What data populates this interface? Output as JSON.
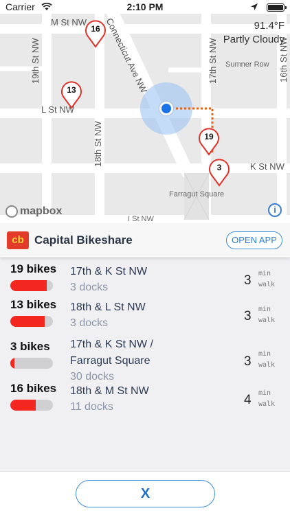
{
  "status_bar": {
    "carrier": "Carrier",
    "time": "2:10 PM",
    "icons": [
      "wifi-icon",
      "location-arrow-icon",
      "battery-icon"
    ]
  },
  "map": {
    "weather": {
      "temperature": "91.4°F",
      "condition": "Partly Cloudy"
    },
    "streets": {
      "m_st": "M St NW",
      "connecticut": "Connecticut Ave NW",
      "st_19th": "19th St NW",
      "st_17th": "17th St NW",
      "st_16th": "16th St NW",
      "sumner": "Sumner Row",
      "l_st": "L St NW",
      "st_18th": "18th St NW",
      "k_st": "K St NW",
      "farragut": "Farragut Square",
      "i_st": "I St NW"
    },
    "markers": [
      "16",
      "13",
      "19",
      "3"
    ],
    "attribution": "mapbox",
    "info_label": "i"
  },
  "header": {
    "logo_text": "cb",
    "title": "Capital Bikeshare",
    "open_app": "OPEN APP"
  },
  "stations": [
    {
      "bikes": "19 bikes",
      "name": "17th & K St NW",
      "docks": "3 docks",
      "walk": "3",
      "fill": 0.86
    },
    {
      "bikes": "13 bikes",
      "name": "18th & L St NW",
      "docks": "3 docks",
      "walk": "3",
      "fill": 0.81
    },
    {
      "bikes": "3 bikes",
      "name": "17th & K St NW /",
      "name2": "Farragut Square",
      "docks": "30 docks",
      "walk": "3",
      "fill": 0.09
    },
    {
      "bikes": "16 bikes",
      "name": "18th & M St NW",
      "docks": "11 docks",
      "walk": "4",
      "fill": 0.59
    }
  ],
  "walk_unit": {
    "line1": "min",
    "line2": "walk"
  },
  "footer": {
    "close_label": "X"
  },
  "colors": {
    "accent": "#3a8dd9",
    "bar_fill": "#f3271f",
    "marker": "#e0312b",
    "user_dot": "#1a73e8"
  }
}
